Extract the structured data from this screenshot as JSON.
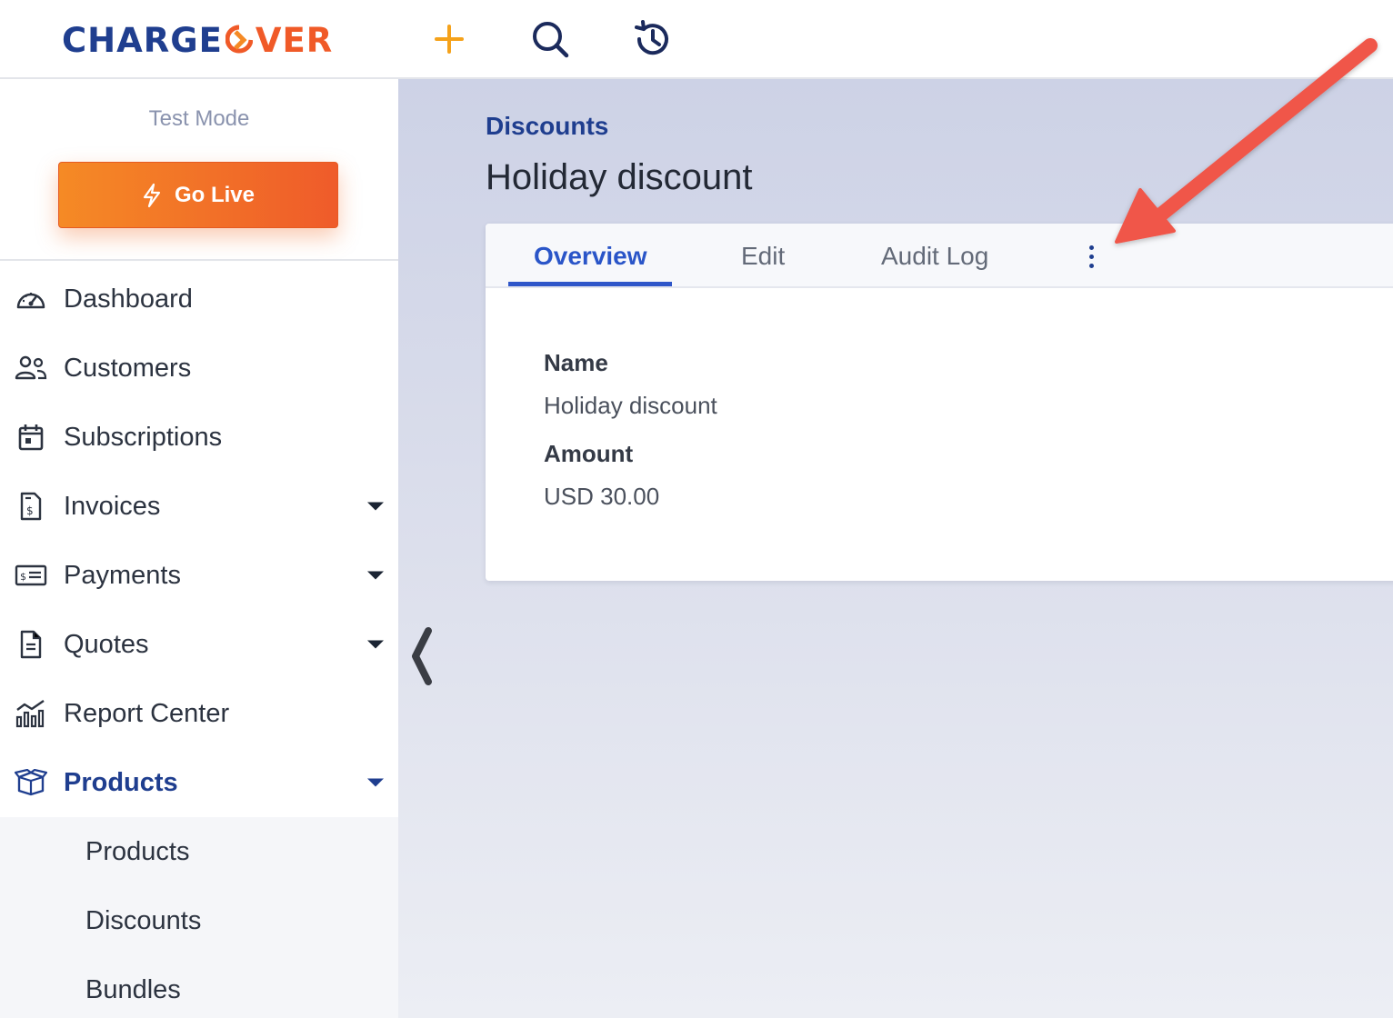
{
  "brand": {
    "part1": "CHARGE",
    "part2": "VER"
  },
  "sidebar": {
    "test_mode": "Test Mode",
    "go_live": "Go Live",
    "items": [
      {
        "label": "Dashboard",
        "icon": "dashboard-icon"
      },
      {
        "label": "Customers",
        "icon": "customers-icon"
      },
      {
        "label": "Subscriptions",
        "icon": "calendar-icon"
      },
      {
        "label": "Invoices",
        "icon": "invoice-icon"
      },
      {
        "label": "Payments",
        "icon": "payment-icon"
      },
      {
        "label": "Quotes",
        "icon": "quote-icon"
      },
      {
        "label": "Report Center",
        "icon": "report-icon"
      },
      {
        "label": "Products",
        "icon": "box-icon"
      }
    ],
    "sub_items": [
      {
        "label": "Products"
      },
      {
        "label": "Discounts"
      },
      {
        "label": "Bundles"
      }
    ]
  },
  "main": {
    "breadcrumb": "Discounts",
    "title": "Holiday discount",
    "tabs": [
      {
        "label": "Overview"
      },
      {
        "label": "Edit"
      },
      {
        "label": "Audit Log"
      }
    ],
    "fields": [
      {
        "label": "Name",
        "value": "Holiday discount"
      },
      {
        "label": "Amount",
        "value": "USD 30.00"
      }
    ]
  },
  "colors": {
    "brand_blue": "#1f3e8f",
    "brand_orange": "#f05a28",
    "tab_active": "#2f56c9",
    "annotation_arrow": "#f0564a"
  }
}
